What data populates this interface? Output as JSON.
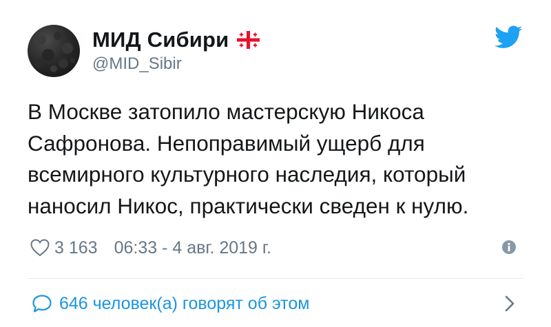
{
  "account": {
    "name": "МИД Сибири",
    "handle": "@MID_Sibir"
  },
  "tweet": {
    "lines": [
      "В Москве затопило мастерскую Никоса",
      "Сафронова. Непоправимый ущерб для",
      "всемирного культурного наследия, который",
      "наносил Никос, практически сведен к нулю."
    ],
    "likes": "3 163",
    "timestamp": "06:33 - 4 авг. 2019 г."
  },
  "footer": {
    "replies_label": "646 человек(а) говорят об этом"
  },
  "colors": {
    "accent": "#1b95e0",
    "secondary_text": "#657786",
    "flag_red": "#e8112d"
  },
  "icons": {
    "bird": "twitter-bird-icon",
    "heart": "heart-icon",
    "info": "info-icon",
    "bubble": "speech-bubble-icon",
    "chevron": "chevron-right-icon",
    "flag": "georgia-flag-icon"
  }
}
